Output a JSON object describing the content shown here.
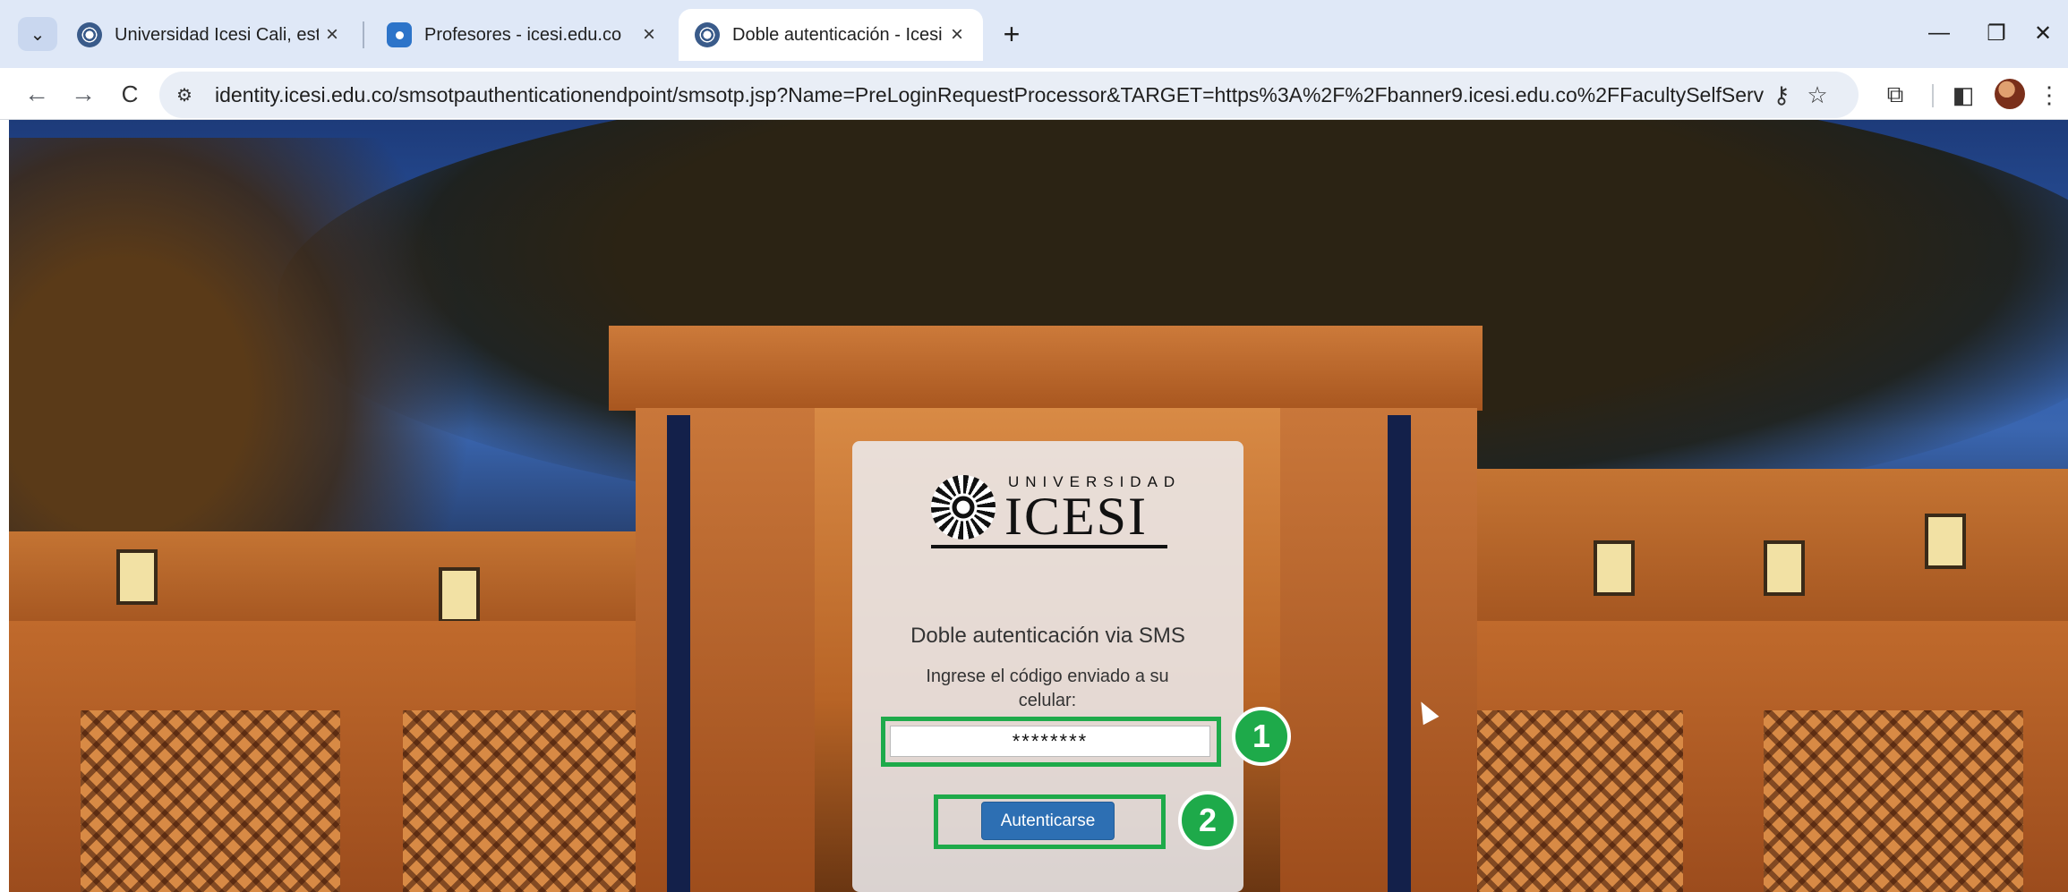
{
  "browser": {
    "tabs": [
      {
        "title": "Universidad Icesi Cali, estudia en",
        "favicon": "icesi-seal-icon",
        "active": false
      },
      {
        "title": "Profesores - icesi.edu.co",
        "favicon": "profesores-site-icon",
        "active": false
      },
      {
        "title": "Doble autenticación - Icesi",
        "favicon": "icesi-seal-icon",
        "active": true
      }
    ],
    "tab_close_glyph": "×",
    "new_tab_glyph": "+",
    "url": "identity.icesi.edu.co/smsotpauthenticationendpoint/smsotp.jsp?Name=PreLoginRequestProcessor&TARGET=https%3A%2F%2Fbanner9.icesi.edu.co%2FFacultySelfService%2Flogin%2Fcas&com...",
    "icons": {
      "tab_search": "⌄",
      "back": "←",
      "forward": "→",
      "reload": "C",
      "site_info": "⚙",
      "password_key": "⚷",
      "bookmark_star": "☆",
      "extensions": "⧉",
      "side_panel": "◧",
      "menu": "⋮",
      "minimize": "—",
      "restore": "❐",
      "close": "✕"
    }
  },
  "page": {
    "logo": {
      "small_text": "UNIVERSIDAD",
      "big_text": "ICESI"
    },
    "heading": "Doble autenticación via SMS",
    "instruction": "Ingrese el código enviado a su celular:",
    "otp_value": "********",
    "submit_label": "Autenticarse",
    "annotations": [
      "1",
      "2"
    ],
    "accent_color": "#1eaa4a",
    "button_color": "#2d6fb3"
  }
}
